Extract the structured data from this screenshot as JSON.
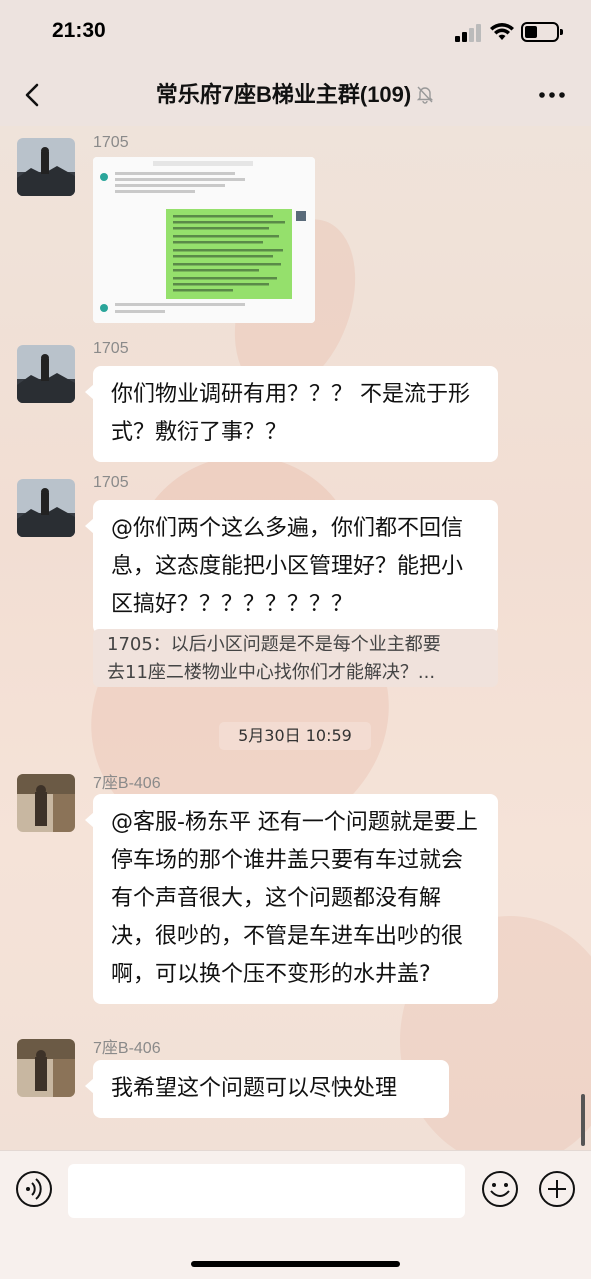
{
  "status_bar": {
    "time": "21:30"
  },
  "header": {
    "title": "常乐府7座B梯业主群(109)",
    "back_icon": "chevron-left-icon",
    "more_icon": "more-horizontal-icon",
    "muted_icon": "bell-off-icon"
  },
  "messages": [
    {
      "sender": "1705",
      "type": "image",
      "icon": "screenshot-image"
    },
    {
      "sender": "1705",
      "text": "你们物业调研有用？？？ 不是流于形式？敷衍了事？？"
    },
    {
      "sender": "1705",
      "text": "@你们两个这么多遍，你们都不回信息，这态度能把小区管理好？能把小区搞好？？？？？？？？",
      "quote": {
        "line1": "1705：以后小区问题是不是每个业主都要",
        "line2": "去11座二楼物业中心找你们才能解决？..."
      }
    },
    {
      "type": "time",
      "text": "5月30日 10:59"
    },
    {
      "sender": "7座B-406",
      "text": "@客服-杨东平 还有一个问题就是要上停车场的那个谁井盖只要有车过就会有个声音很大，这个问题都没有解决，很吵的，不管是车进车出吵的很啊，可以换个压不变形的水井盖?"
    },
    {
      "sender": "7座B-406",
      "text": "我希望这个问题可以尽快处理"
    }
  ],
  "input_bar": {
    "text": "",
    "voice_icon": "voice-icon",
    "emoji_icon": "emoji-icon",
    "plus_icon": "plus-circle-icon"
  },
  "colors": {
    "bubble": "#ffffff",
    "background": "#f3e4dc",
    "quote_bg": "#f0e2dc"
  }
}
